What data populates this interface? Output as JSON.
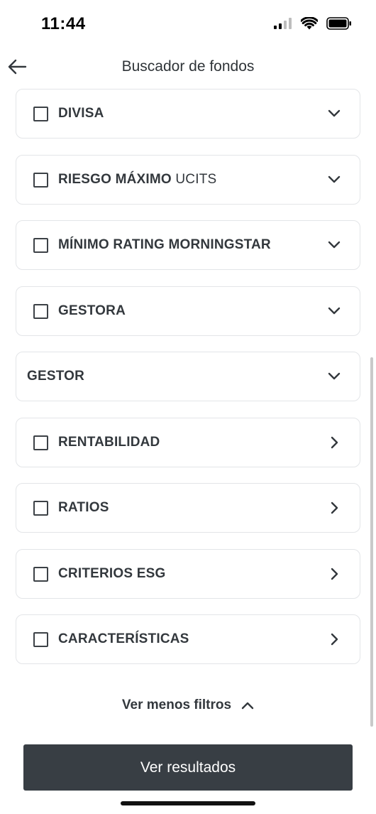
{
  "status_bar": {
    "time": "11:44"
  },
  "nav": {
    "title": "Buscador de fondos",
    "back_icon": "arrow-left-icon"
  },
  "filters": [
    {
      "label": "DIVISA",
      "suffix": "",
      "checkbox": true,
      "checked": false,
      "chevron": "chevron-down-icon"
    },
    {
      "label": "RIESGO MÁXIMO",
      "suffix": " UCITS",
      "checkbox": true,
      "checked": false,
      "chevron": "chevron-down-icon"
    },
    {
      "label": "MÍNIMO RATING MORNINGSTAR",
      "suffix": "",
      "checkbox": true,
      "checked": false,
      "chevron": "chevron-down-icon"
    },
    {
      "label": "GESTORA",
      "suffix": "",
      "checkbox": true,
      "checked": false,
      "chevron": "chevron-down-icon"
    },
    {
      "label": "GESTOR",
      "suffix": "",
      "checkbox": false,
      "checked": false,
      "chevron": "chevron-down-icon"
    },
    {
      "label": "RENTABILIDAD",
      "suffix": "",
      "checkbox": true,
      "checked": false,
      "chevron": "chevron-right-icon"
    },
    {
      "label": "RATIOS",
      "suffix": "",
      "checkbox": true,
      "checked": false,
      "chevron": "chevron-right-icon"
    },
    {
      "label": "CRITERIOS ESG",
      "suffix": "",
      "checkbox": true,
      "checked": false,
      "chevron": "chevron-right-icon"
    },
    {
      "label": "CARACTERÍSTICAS",
      "suffix": "",
      "checkbox": true,
      "checked": false,
      "chevron": "chevron-right-icon"
    }
  ],
  "toggle": {
    "label": "Ver menos filtros",
    "icon": "chevron-up-icon"
  },
  "results_button": {
    "label": "Ver resultados"
  },
  "colors": {
    "text": "#33383d",
    "button_bg": "#383e44",
    "card_border": "#e3e5e8"
  }
}
